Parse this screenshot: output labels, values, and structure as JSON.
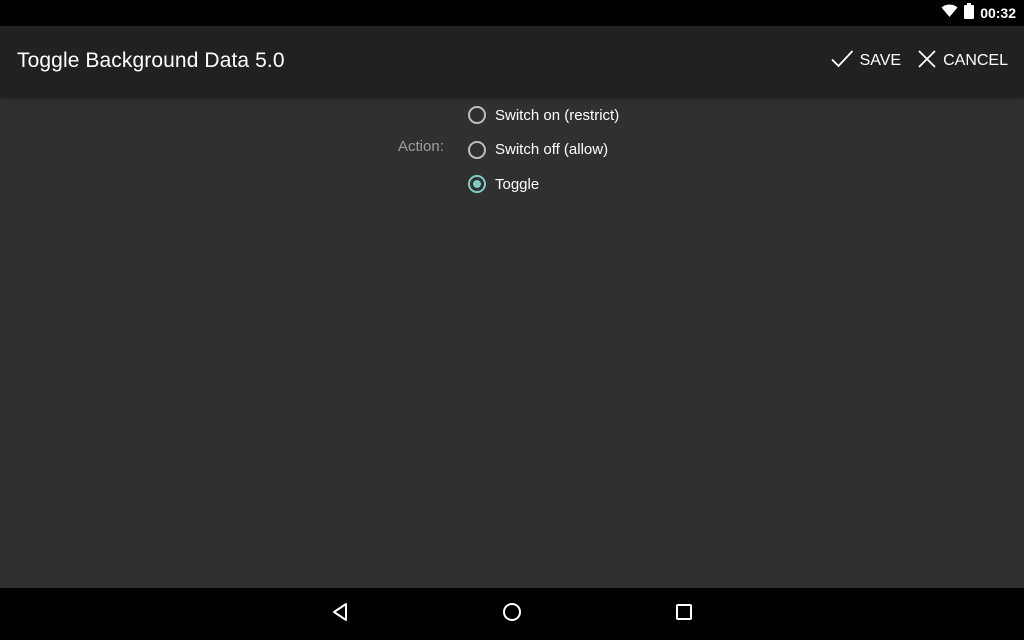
{
  "status_bar": {
    "time": "00:32",
    "icons": [
      "wifi-icon",
      "battery-icon"
    ]
  },
  "action_bar": {
    "title": "Toggle Background Data 5.0",
    "save_label": "SAVE",
    "cancel_label": "CANCEL",
    "save_icon": "checkmark-icon",
    "cancel_icon": "close-icon"
  },
  "form": {
    "action_label": "Action:",
    "options": [
      {
        "label": "Switch on (restrict)",
        "checked": false
      },
      {
        "label": "Switch off (allow)",
        "checked": false
      },
      {
        "label": "Toggle",
        "checked": true
      }
    ]
  },
  "nav_bar": {
    "icons": [
      "back-icon",
      "home-icon",
      "recents-icon"
    ]
  },
  "colors": {
    "accent": "#80cbc4",
    "background": "#303030",
    "action_bar": "#212121",
    "system_bars": "#000000"
  }
}
